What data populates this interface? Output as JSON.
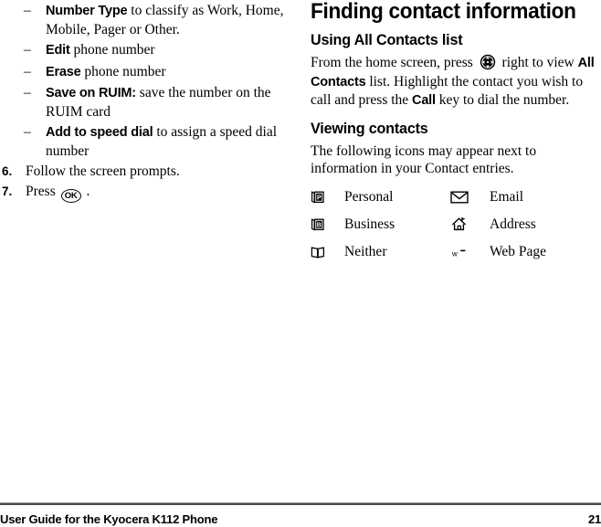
{
  "document": {
    "footer": {
      "left_text": "User Guide for the Kyocera K112 Phone",
      "page_number": "21"
    }
  },
  "left_column": {
    "sub_list": [
      {
        "dash": "–",
        "term": "Number Type",
        "rest": " to classify as Work, Home, Mobile, Pager or Other."
      },
      {
        "dash": "–",
        "term": "Edit",
        "rest": " phone number"
      },
      {
        "dash": "–",
        "term": "Erase",
        "rest": " phone number"
      },
      {
        "dash": "–",
        "term": "Save on RUIM:",
        "rest": " save the number on the RUIM card"
      },
      {
        "dash": "–",
        "term": "Add to speed dial",
        "rest": " to assign a speed dial number"
      }
    ],
    "steps": [
      {
        "number": "6.",
        "text": "Follow the screen prompts."
      },
      {
        "number": "7.",
        "text_before": "Press ",
        "key_label": "OK",
        "text_after": " ."
      }
    ]
  },
  "right_column": {
    "heading": "Finding contact information",
    "subheading_1": "Using All Contacts list",
    "paragraph_1": {
      "part_1": "From the home screen, press ",
      "part_2": " right to view ",
      "bold_1": "All Contacts",
      "part_3": " list. Highlight the contact you wish to call and press the ",
      "bold_2": "Call",
      "part_4": " key to dial the number."
    },
    "subheading_2": "Viewing contacts",
    "paragraph_2": "The following icons may appear next to information in your Contact entries.",
    "icon_legend": [
      {
        "icon_left": "book-p-icon",
        "label_left": "Personal",
        "icon_right": "envelope-icon",
        "label_right": "Email"
      },
      {
        "icon_left": "book-b-icon",
        "label_left": "Business",
        "icon_right": "house-icon",
        "label_right": "Address"
      },
      {
        "icon_left": "book-plain-icon",
        "label_left": "Neither",
        "icon_right": "web-icon",
        "label_right": "Web Page"
      }
    ]
  }
}
